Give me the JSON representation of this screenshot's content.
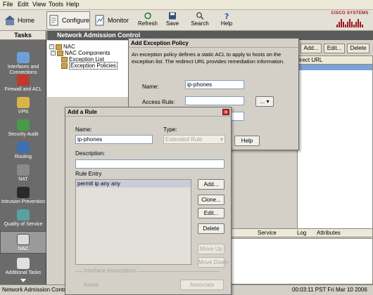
{
  "menu": [
    "File",
    "Edit",
    "View",
    "Tools",
    "Help"
  ],
  "toolbar": {
    "home": "Home",
    "configure": "Configure",
    "monitor": "Monitor",
    "refresh": "Refresh",
    "save": "Save",
    "search": "Search",
    "help": "Help",
    "logo_text": "CISCO SYSTEMS"
  },
  "tasks": {
    "header": "Tasks",
    "items": [
      {
        "label": "Interfaces and Connections",
        "icon": "interfaces-icon"
      },
      {
        "label": "Firewall and ACL",
        "icon": "firewall-icon"
      },
      {
        "label": "VPN",
        "icon": "vpn-icon"
      },
      {
        "label": "Security Audit",
        "icon": "security-audit-icon"
      },
      {
        "label": "Routing",
        "icon": "routing-icon"
      },
      {
        "label": "NAT",
        "icon": "nat-icon"
      },
      {
        "label": "Intrusion Prevention",
        "icon": "intrusion-prevention-icon"
      },
      {
        "label": "Quality of Service",
        "icon": "qos-icon"
      },
      {
        "label": "NAC",
        "icon": "nac-icon"
      },
      {
        "label": "Additional Tasks",
        "icon": "additional-tasks-icon"
      }
    ]
  },
  "main": {
    "title": "Network Admission Control",
    "tree": [
      "NAC",
      "NAC Components",
      "Exception List",
      "Exception Policies"
    ],
    "buttons": {
      "add": "Add...",
      "edit": "Edit...",
      "delete": "Delete"
    },
    "grid_header": "irect URL",
    "bottom_cols": [
      "Service",
      "Log",
      "Attributes"
    ]
  },
  "exception_dialog": {
    "title": "Add Exception Policy",
    "description": "An exception policy defines a static ACL to apply to hosts on the exception list. The redirect URL provides remediation information.",
    "name_label": "Name:",
    "name_value": "ip-phones",
    "access_rule_label": "Access Rule:",
    "browse_label": "...",
    "help_label": "Help"
  },
  "rule_dialog": {
    "title": "Add a Rule",
    "name_label": "Name:",
    "name_value": "ip-phones",
    "type_label": "Type:",
    "type_value": "Extended Rule",
    "description_label": "Description:",
    "rule_entry_label": "Rule Entry",
    "rule_entries": [
      "permit ip any any"
    ],
    "add_label": "Add...",
    "clone_label": "Clone...",
    "edit_label": "Edit...",
    "delete_label": "Delete",
    "move_up_label": "Move Up",
    "move_down_label": "Move Down",
    "interface_section": "Interface Association",
    "name2_label": "Name",
    "associate_label": "Associate"
  },
  "status": {
    "left": "Network Admission Control",
    "right": "00:03:11 PST Fri Mar 10 2006"
  }
}
